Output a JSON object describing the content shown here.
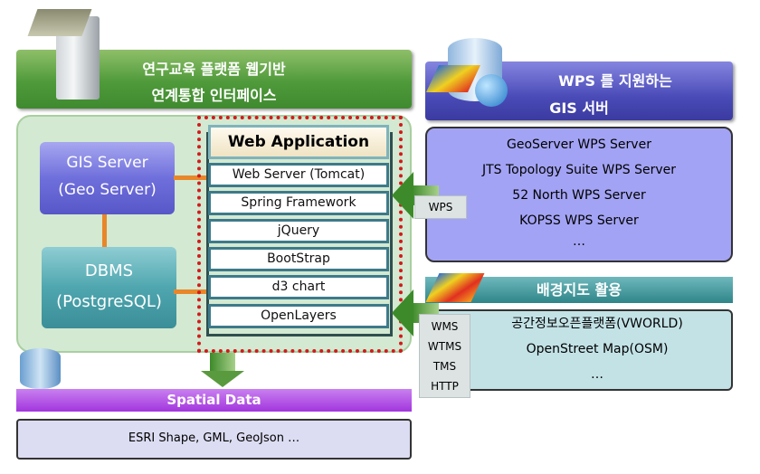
{
  "interface": {
    "title_line1": "연구교육 플랫폼 웹기반",
    "title_line2": "연계통합 인터페이스"
  },
  "gis_server": {
    "line1": "GIS Server",
    "line2": "(Geo Server)"
  },
  "dbms": {
    "line1": "DBMS",
    "line2": "(PostgreSQL)"
  },
  "web_app": {
    "title": "Web Application",
    "layers": [
      "Web Server (Tomcat)",
      "Spring Framework",
      "jQuery",
      "BootStrap",
      "d3 chart",
      "OpenLayers"
    ]
  },
  "spatial_data": {
    "title": "Spatial Data",
    "formats": "ESRI Shape, GML, GeoJson …"
  },
  "wps": {
    "title_line1": "WPS 를 지원하는",
    "title_line2": "GIS 서버",
    "servers": [
      "GeoServer WPS Server",
      "JTS Topology Suite WPS Server",
      "52 North WPS Server",
      "KOPSS WPS Server",
      "…"
    ],
    "protocol": "WPS"
  },
  "basemap": {
    "title": "배경지도 활용",
    "sources": [
      "공간정보오픈플랫폼(VWORLD)",
      "OpenStreet Map(OSM)",
      "…"
    ],
    "protocols": [
      "WMS",
      "WTMS",
      "TMS",
      "HTTP"
    ]
  },
  "colors": {
    "red_boundary": "#d21a1a",
    "green_header": "#4f9a3a",
    "arrow_orange": "#e8872a",
    "spatial_purple": "#a235dd"
  }
}
